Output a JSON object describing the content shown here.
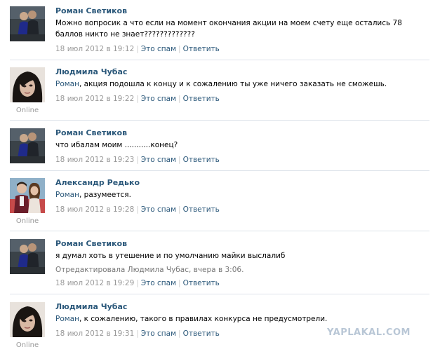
{
  "comments": [
    {
      "author": "Роман Светиков",
      "text_addr": "",
      "text_rest": "Можно вопросик а что если на момент окончания акции на моем счету еще остались 78 баллов никто не знает?????????????",
      "edited": "",
      "date": "18 июл 2012 в 19:12",
      "spam": "Это спам",
      "reply": "Ответить",
      "online": ""
    },
    {
      "author": "Людмила Чубас",
      "text_addr": "Роман",
      "text_rest": ", акция подошла к концу и к сожалению ты уже ничего заказать не сможешь.",
      "edited": "",
      "date": "18 июл 2012 в 19:22",
      "spam": "Это спам",
      "reply": "Ответить",
      "online": "Online"
    },
    {
      "author": "Роман Светиков",
      "text_addr": "",
      "text_rest": "что ибалам моим ...........конец?",
      "edited": "",
      "date": "18 июл 2012 в 19:23",
      "spam": "Это спам",
      "reply": "Ответить",
      "online": ""
    },
    {
      "author": "Александр Редько",
      "text_addr": "Роман",
      "text_rest": ", разумеется.",
      "edited": "",
      "date": "18 июл 2012 в 19:28",
      "spam": "Это спам",
      "reply": "Ответить",
      "online": "Online"
    },
    {
      "author": "Роман Светиков",
      "text_addr": "",
      "text_rest": "я думал хоть в утешение и по умолчанию майки выслалиб",
      "edited": "Отредактировала Людмила Чубас, вчера в 3:06.",
      "date": "18 июл 2012 в 19:29",
      "spam": "Это спам",
      "reply": "Ответить",
      "online": ""
    },
    {
      "author": "Людмила Чубас",
      "text_addr": "Роман",
      "text_rest": ", к сожалению, такого в правилах конкурса не предусмотрели.",
      "edited": "",
      "date": "18 июл 2012 в 19:31",
      "spam": "Это спам",
      "reply": "Ответить",
      "online": "Online"
    }
  ],
  "watermark": "YAPLAKAL.COM"
}
